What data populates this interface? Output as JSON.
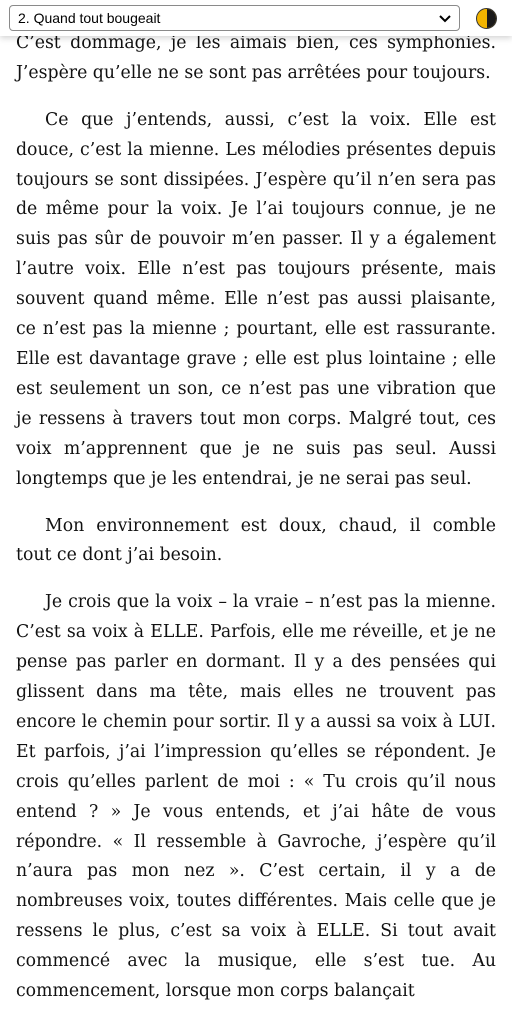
{
  "toolbar": {
    "chapter_selected": "2. Quand tout bougeait",
    "chapter_dropdown_icon": "chevron-down-icon",
    "theme_toggle_icon": "half-circle-theme-icon",
    "theme_colors": {
      "light": "#f2b400",
      "dark": "#1a1a1a"
    }
  },
  "content": {
    "paragraphs": [
      "sous que je ressens davantage que je ne l’entends. C’est dommage, je les aimais bien, ces symphonies. J’espère qu’elle ne se sont pas arrêtées pour toujours.",
      "Ce que j’entends, aussi, c’est la voix. Elle est douce, c’est la mienne. Les mélodies présentes depuis toujours se sont dissipées. J’espère qu’il n’en sera pas de même pour la voix. Je l’ai toujours connue, je ne suis pas sûr de pouvoir m’en passer. Il y a également l’autre voix. Elle n’est pas toujours présente, mais souvent quand même. Elle n’est pas aussi plaisante, ce n’est pas la mienne ; pourtant, elle est rassurante. Elle est davantage grave ; elle est plus lointaine ; elle est seulement un son, ce n’est pas une vibration que je ressens à travers tout mon corps. Malgré tout, ces voix m’apprennent que je ne suis pas seul. Aussi longtemps que je les entendrai, je ne serai pas seul.",
      "Mon environnement est doux, chaud, il comble tout ce dont j’ai besoin.",
      "Je crois que la voix – la vraie – n’est pas la mienne. C’est sa voix à ELLE. Parfois, elle me réveille, et je ne pense pas parler en dormant. Il y a des pensées qui glissent dans ma tête, mais elles ne trouvent pas encore le chemin pour sortir. Il y a aussi sa voix à LUI. Et parfois, j’ai l’impression qu’elles se répondent. Je crois qu’elles parlent de moi : « Tu crois qu’il nous entend ? » Je vous entends, et j’ai hâte de vous répondre. « Il ressemble à Gavroche, j’espère qu’il n’aura pas mon nez ». C’est certain, il y a de nombreuses voix, toutes différentes. Mais celle que je ressens le plus, c’est sa voix à ELLE. Si tout avait commencé avec la musique, elle s’est tue. Au commencement, lorsque mon corps balançait"
    ]
  }
}
